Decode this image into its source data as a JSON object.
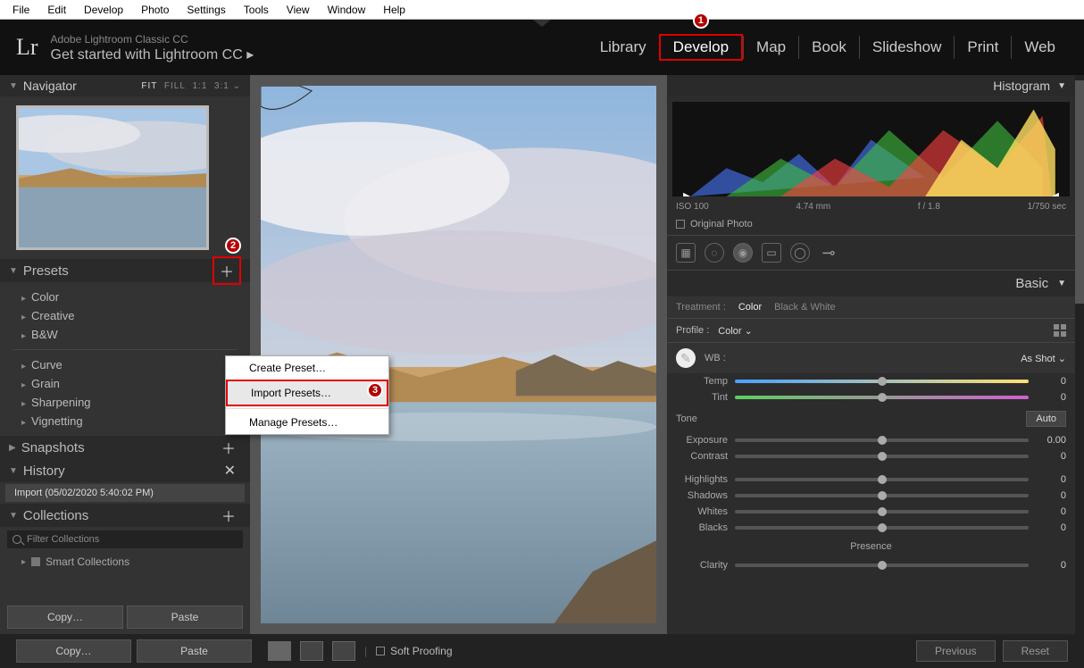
{
  "menu": {
    "items": [
      "File",
      "Edit",
      "Develop",
      "Photo",
      "Settings",
      "Tools",
      "View",
      "Window",
      "Help"
    ]
  },
  "header": {
    "logo": "Lr",
    "subtitle": "Adobe Lightroom Classic CC",
    "title": "Get started with Lightroom CC  ▸",
    "modules": [
      "Library",
      "Develop",
      "Map",
      "Book",
      "Slideshow",
      "Print",
      "Web"
    ],
    "active_module": "Develop"
  },
  "left": {
    "navigator": {
      "label": "Navigator",
      "opts_html": "FIT  FILL  1:1  3:1 ⌄",
      "fit": "FIT"
    },
    "presets": {
      "label": "Presets",
      "groups1": [
        "Color",
        "Creative",
        "B&W"
      ],
      "groups2": [
        "Curve",
        "Grain",
        "Sharpening",
        "Vignetting"
      ]
    },
    "snapshots": {
      "label": "Snapshots"
    },
    "history": {
      "label": "History",
      "entry": "Import (05/02/2020 5:40:02 PM)"
    },
    "collections": {
      "label": "Collections",
      "filter_placeholder": "Filter Collections",
      "smart": "Smart Collections"
    },
    "copy": "Copy…",
    "paste": "Paste"
  },
  "ctx_menu": {
    "items": [
      "Create Preset…",
      "Import Presets…",
      "Manage Presets…"
    ],
    "highlight_index": 1
  },
  "right": {
    "histogram": {
      "label": "Histogram",
      "iso": "ISO 100",
      "focal": "4.74 mm",
      "aperture": "f / 1.8",
      "shutter": "1/750 sec",
      "original": "Original Photo"
    },
    "basic": {
      "label": "Basic",
      "treatment_label": "Treatment :",
      "treatment_color": "Color",
      "treatment_bw": "Black & White",
      "profile_label": "Profile :",
      "profile_value": "Color  ⌄",
      "wb_label": "WB :",
      "wb_value": "As Shot ⌄",
      "temp": {
        "label": "Temp",
        "value": "0"
      },
      "tint": {
        "label": "Tint",
        "value": "0"
      },
      "tone_label": "Tone",
      "auto": "Auto",
      "exposure": {
        "label": "Exposure",
        "value": "0.00"
      },
      "contrast": {
        "label": "Contrast",
        "value": "0"
      },
      "highlights": {
        "label": "Highlights",
        "value": "0"
      },
      "shadows": {
        "label": "Shadows",
        "value": "0"
      },
      "whites": {
        "label": "Whites",
        "value": "0"
      },
      "blacks": {
        "label": "Blacks",
        "value": "0"
      },
      "presence_label": "Presence",
      "clarity": {
        "label": "Clarity",
        "value": "0"
      }
    }
  },
  "bottom": {
    "soft_proofing": "Soft Proofing",
    "previous": "Previous",
    "reset": "Reset"
  },
  "annotations": {
    "m1": "1",
    "m2": "2",
    "m3": "3"
  }
}
